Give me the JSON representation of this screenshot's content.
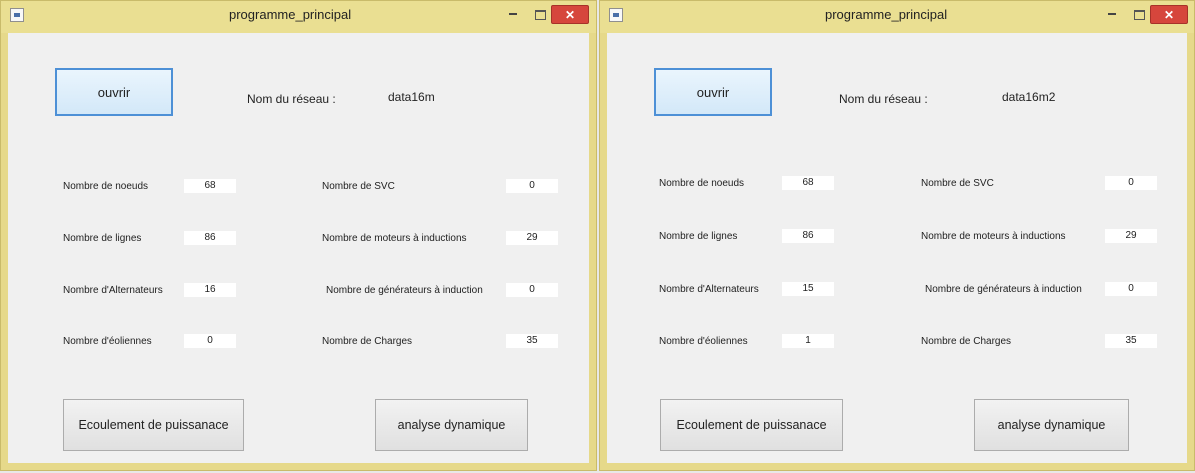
{
  "windows": [
    {
      "title": "programme_principal",
      "open_label": "ouvrir",
      "network_label": "Nom du réseau :",
      "network_name": "data16m",
      "left_fields": [
        {
          "label": "Nombre de noeuds",
          "value": "68"
        },
        {
          "label": "Nombre de lignes",
          "value": "86"
        },
        {
          "label": "Nombre d'Alternateurs",
          "value": "16"
        },
        {
          "label": "Nombre d'éoliennes",
          "value": "0"
        }
      ],
      "right_fields": [
        {
          "label": "Nombre de SVC",
          "value": "0"
        },
        {
          "label": "Nombre de moteurs à inductions",
          "value": "29"
        },
        {
          "label": "Nombre de générateurs à induction",
          "value": "0"
        },
        {
          "label": "Nombre de Charges",
          "value": "35"
        }
      ],
      "flow_label": "Ecoulement de puissanace",
      "dynamic_label": "analyse dynamique"
    },
    {
      "title": "programme_principal",
      "open_label": "ouvrir",
      "network_label": "Nom du réseau :",
      "network_name": "data16m2",
      "left_fields": [
        {
          "label": "Nombre de noeuds",
          "value": "68"
        },
        {
          "label": "Nombre de lignes",
          "value": "86"
        },
        {
          "label": "Nombre d'Alternateurs",
          "value": "15"
        },
        {
          "label": "Nombre d'éoliennes",
          "value": "1"
        }
      ],
      "right_fields": [
        {
          "label": "Nombre de SVC",
          "value": "0"
        },
        {
          "label": "Nombre de moteurs à inductions",
          "value": "29"
        },
        {
          "label": "Nombre de générateurs à induction",
          "value": "0"
        },
        {
          "label": "Nombre de Charges",
          "value": "35"
        }
      ],
      "flow_label": "Ecoulement de puissanace",
      "dynamic_label": "analyse dynamique"
    }
  ],
  "icons": {
    "app": "matlab-figure-icon",
    "minimize": "minimize-icon",
    "maximize": "maximize-icon",
    "close": "close-icon"
  },
  "colors": {
    "title_bar": "#eadf92",
    "close_button": "#d6463c",
    "open_button_border": "#4d90d6",
    "client_background": "#f0f0f0"
  }
}
